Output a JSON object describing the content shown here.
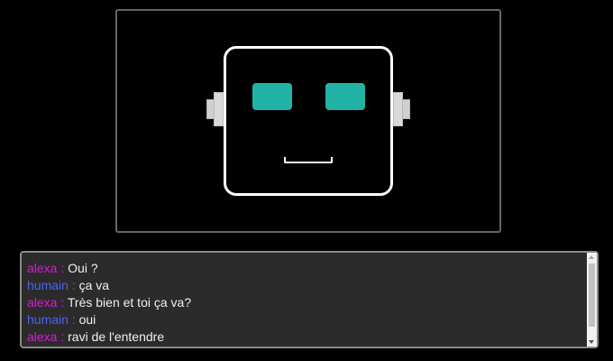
{
  "robot": {
    "eye_color": "#20b3a6",
    "face_stroke_color": "#ffffff",
    "ear_color": "#d9d9d9"
  },
  "chat": {
    "messages": [
      {
        "speaker": "alexa :",
        "text": "Oui ?"
      },
      {
        "speaker": "humain :",
        "text": "ça va"
      },
      {
        "speaker": "alexa :",
        "text": "Très bien et toi ça va?"
      },
      {
        "speaker": "humain :",
        "text": "oui"
      },
      {
        "speaker": "alexa :",
        "text": "ravi de l'entendre"
      }
    ],
    "colors": {
      "alexa": "#d81bd8",
      "humain": "#4a63f2",
      "text": "#f0f0f0",
      "background": "#2b2b2b"
    }
  }
}
